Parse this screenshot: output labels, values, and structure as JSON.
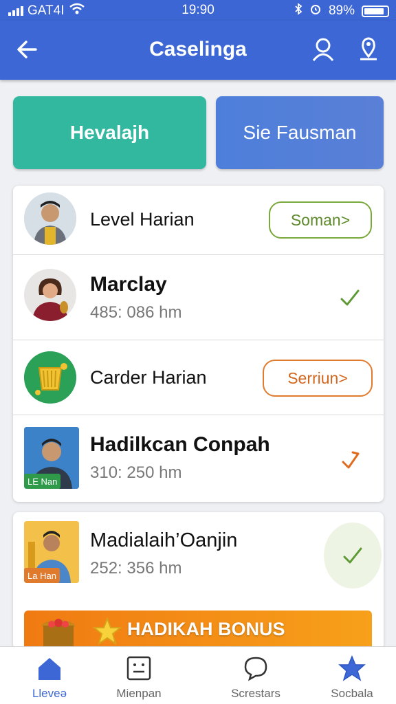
{
  "status_bar": {
    "carrier": "GAT4I",
    "time": "19:90",
    "battery": "89%",
    "icons": [
      "signal-icon",
      "wifi-icon",
      "bluetooth-icon",
      "alarm-icon",
      "battery-icon"
    ]
  },
  "app_bar": {
    "title": "Caselinga",
    "icons": [
      "back-arrow-icon",
      "user-icon",
      "location-pin-icon"
    ]
  },
  "tiles": [
    {
      "label": "Hevalajh",
      "color": "#33b8a0"
    },
    {
      "label": "Sie Fausman",
      "color": "#4d7fda"
    }
  ],
  "rows": [
    {
      "name": "Level Harian",
      "button": "Soman>"
    },
    {
      "name": "Marclay",
      "sub": "485: 086 hm"
    },
    {
      "name": "Carder Harian",
      "button": "Serriun>"
    },
    {
      "name": "Hadilkcan Conpah",
      "sub": "310: 250 hm",
      "tag": "LE Nan"
    },
    {
      "name": "Madialaih’Oanjin",
      "sub": "252: 356 hm",
      "tag": "La Han"
    }
  ],
  "bonus": {
    "label": "HADIKAH BONUS"
  },
  "bottom_nav": [
    {
      "label": "Lleveə",
      "icon": "home-icon",
      "active": true
    },
    {
      "label": "Mienpan",
      "icon": "list-card-icon"
    },
    {
      "label": "Screstars",
      "icon": "chat-bubble-icon"
    },
    {
      "label": "Socbala",
      "icon": "star-icon"
    }
  ],
  "colors": {
    "primary": "#3d67d4",
    "teal": "#33b8a0",
    "olive": "#7aa83a",
    "orange": "#e07b2e",
    "bonus": "#f07a12"
  }
}
